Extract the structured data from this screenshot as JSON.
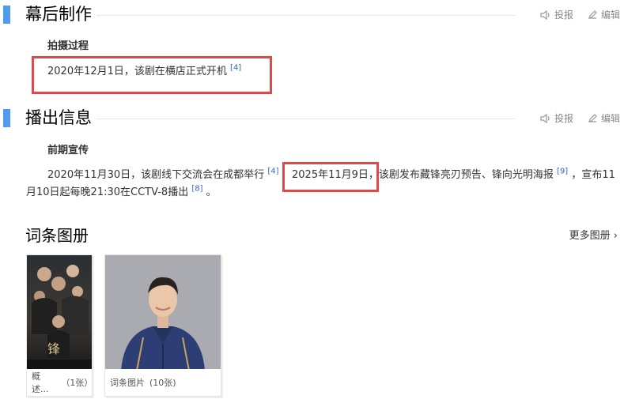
{
  "section1": {
    "title": "幕后制作",
    "report_label": "投报",
    "edit_label": "编辑",
    "subheading": "拍摄过程",
    "para_text": "2020年12月1日，该剧在横店正式开机",
    "para_ref": "[4]"
  },
  "section2": {
    "title": "播出信息",
    "report_label": "投报",
    "edit_label": "编辑",
    "subheading": "前期宣传",
    "p_a": "2020年11月30日，该剧线下交流会在成都举行",
    "ref_a": "[4]",
    "p_b": "2025年11月9日，该剧发布藏锋亮刃预告、锋向光明海报",
    "ref_b": "[9]",
    "p_c": "，宣布11",
    "p_d": "月10日起每晚21:30在CCTV-8播出",
    "ref_c": "[8]",
    "p_e": "。"
  },
  "gallery": {
    "title": "词条图册",
    "more_label": "更多图册",
    "albums": [
      {
        "name": "概述...",
        "count": "（1张）"
      },
      {
        "name": "词条图片",
        "count": "(10张)"
      }
    ]
  },
  "colors": {
    "accent_bar": "#4f9cee",
    "highlight_box": "#dd4a4a",
    "link": "#3366cc"
  },
  "icons": {
    "report": "speaker-icon",
    "edit": "pencil-icon",
    "more": "chevron-right-icon"
  }
}
